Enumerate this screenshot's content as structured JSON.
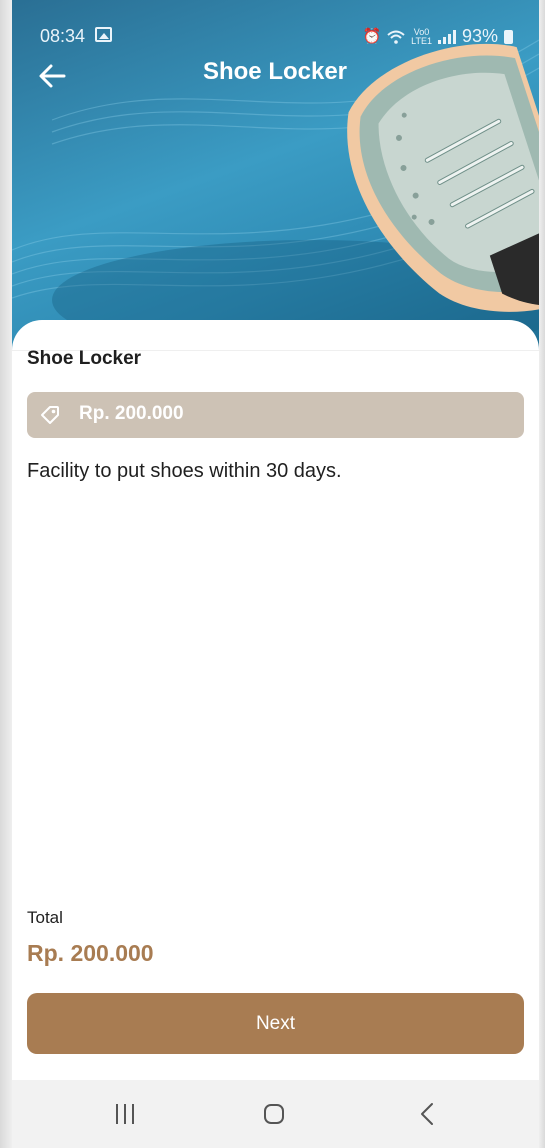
{
  "status_bar": {
    "time": "08:34",
    "network_label_top": "Vo0",
    "network_label_bottom": "LTE1",
    "battery": "93%"
  },
  "header": {
    "title": "Shoe Locker"
  },
  "product": {
    "name": "Shoe Locker",
    "price": "Rp. 200.000",
    "description": "Facility to put shoes within 30 days."
  },
  "summary": {
    "total_label": "Total",
    "total_value": "Rp. 200.000"
  },
  "actions": {
    "next_label": "Next"
  },
  "icons": {
    "back": "arrow-left-icon",
    "tag": "price-tag-icon",
    "gallery": "gallery-icon",
    "alarm": "alarm-icon",
    "wifi": "wifi-icon",
    "signal": "signal-icon",
    "battery": "battery-icon",
    "nav_recent": "recent-apps-icon",
    "nav_home": "home-icon",
    "nav_back": "nav-back-icon"
  },
  "colors": {
    "accent": "#a87c52",
    "price_tag_bg": "#cdc2b5",
    "hero_bg": "#3b9cc4",
    "text": "#1f1f1f"
  }
}
